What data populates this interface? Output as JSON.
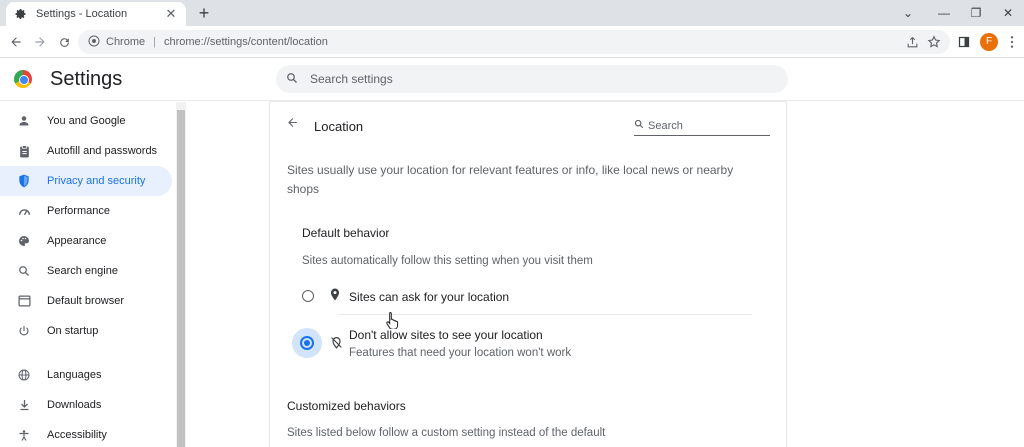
{
  "tab": {
    "title": "Settings - Location",
    "close": "✕",
    "new_tab": "+"
  },
  "window_controls": {
    "minimize": "⌄",
    "min": "—",
    "restore": "❐",
    "close": "✕"
  },
  "toolbar": {
    "origin": "Chrome",
    "url": "chrome://settings/content/location",
    "avatar_letter": "F"
  },
  "header": {
    "title": "Settings",
    "search_placeholder": "Search settings"
  },
  "sidebar": {
    "items": [
      {
        "label": "You and Google",
        "icon": "person-icon"
      },
      {
        "label": "Autofill and passwords",
        "icon": "clipboard-icon"
      },
      {
        "label": "Privacy and security",
        "icon": "shield-icon",
        "active": true
      },
      {
        "label": "Performance",
        "icon": "speedometer-icon"
      },
      {
        "label": "Appearance",
        "icon": "palette-icon"
      },
      {
        "label": "Search engine",
        "icon": "search-icon"
      },
      {
        "label": "Default browser",
        "icon": "browser-icon"
      },
      {
        "label": "On startup",
        "icon": "power-icon"
      },
      {
        "label": "Languages",
        "icon": "globe-icon"
      },
      {
        "label": "Downloads",
        "icon": "download-icon"
      },
      {
        "label": "Accessibility",
        "icon": "accessibility-icon"
      }
    ]
  },
  "page": {
    "title": "Location",
    "search_placeholder": "Search",
    "intro": "Sites usually use your location for relevant features or info, like local news or nearby shops",
    "default_behavior": {
      "heading": "Default behavior",
      "subheading": "Sites automatically follow this setting when you visit them",
      "options": [
        {
          "label": "Sites can ask for your location",
          "sublabel": "",
          "selected": false,
          "icon": "location-pin-icon"
        },
        {
          "label": "Don't allow sites to see your location",
          "sublabel": "Features that need your location won't work",
          "selected": true,
          "icon": "location-off-icon"
        }
      ]
    },
    "customized": {
      "heading": "Customized behaviors",
      "subheading": "Sites listed below follow a custom setting instead of the default"
    }
  },
  "colors": {
    "accent": "#1a73e8",
    "active_bg": "#e8f0fe",
    "avatar": "#e8710a"
  }
}
